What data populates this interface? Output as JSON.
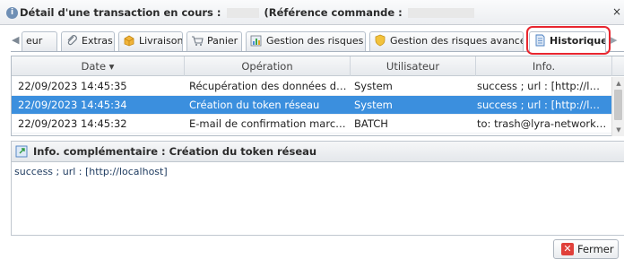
{
  "window": {
    "info_icon_glyph": "i",
    "title_part1": "Détail d'une transaction en cours :",
    "title_part2": "(Référence commande :",
    "close_glyph": "×"
  },
  "tabs": {
    "scroll_left_glyph": "◀",
    "scroll_right_glyph": "▶",
    "items": [
      {
        "label": "eur",
        "icon": "partial-tab"
      },
      {
        "label": "Extras",
        "icon": "paperclip-icon"
      },
      {
        "label": "Livraison",
        "icon": "box-icon"
      },
      {
        "label": "Panier",
        "icon": "cart-icon"
      },
      {
        "label": "Gestion des risques",
        "icon": "chart-icon"
      },
      {
        "label": "Gestion des risques avancée",
        "icon": "shield-icon"
      },
      {
        "label": "Historique",
        "icon": "history-icon"
      }
    ],
    "active_index": 6
  },
  "grid": {
    "columns": [
      "Date ▾",
      "Opération",
      "Utilisateur",
      "Info."
    ],
    "rows": [
      {
        "date": "22/09/2023 14:45:35",
        "operation": "Récupération des données de…",
        "user": "System",
        "info": "success ; url : [http://l…",
        "selected": false
      },
      {
        "date": "22/09/2023 14:45:34",
        "operation": "Création du token réseau",
        "user": "System",
        "info": "success ; url : [http://l…",
        "selected": true
      },
      {
        "date": "22/09/2023 14:45:32",
        "operation": "E-mail de confirmation marc…",
        "user": "BATCH",
        "info": "to: trash@lyra-network…",
        "selected": false
      }
    ]
  },
  "info_panel": {
    "title": "Info. complémentaire : Création du token réseau",
    "content": "success ; url : [http://localhost]"
  },
  "footer": {
    "close_label": "Fermer"
  },
  "colors": {
    "selection": "#3b8fde",
    "active_tab_highlight": "#e8262f",
    "close_icon": "#e0403a"
  }
}
